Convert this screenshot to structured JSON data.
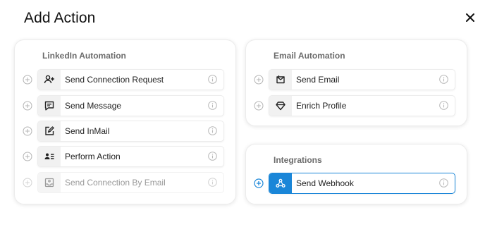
{
  "dialog": {
    "title": "Add Action"
  },
  "linkedin": {
    "title": "LinkedIn Automation",
    "items": [
      {
        "label": "Send Connection Request",
        "icon": "person-add-icon"
      },
      {
        "label": "Send Message",
        "icon": "message-icon"
      },
      {
        "label": "Send InMail",
        "icon": "edit-icon"
      },
      {
        "label": "Perform Action",
        "icon": "contact-card-icon"
      },
      {
        "label": "Send Connection By Email",
        "icon": "inbox-icon",
        "disabled": true
      }
    ]
  },
  "email": {
    "title": "Email Automation",
    "items": [
      {
        "label": "Send Email",
        "icon": "mail-icon"
      },
      {
        "label": "Enrich Profile",
        "icon": "diamond-icon"
      }
    ]
  },
  "integrations": {
    "title": "Integrations",
    "items": [
      {
        "label": "Send Webhook",
        "icon": "webhook-icon",
        "selected": true
      }
    ]
  },
  "colors": {
    "accent": "#1a86d8",
    "text": "#1f1f1f",
    "muted": "#6b6b6b"
  }
}
